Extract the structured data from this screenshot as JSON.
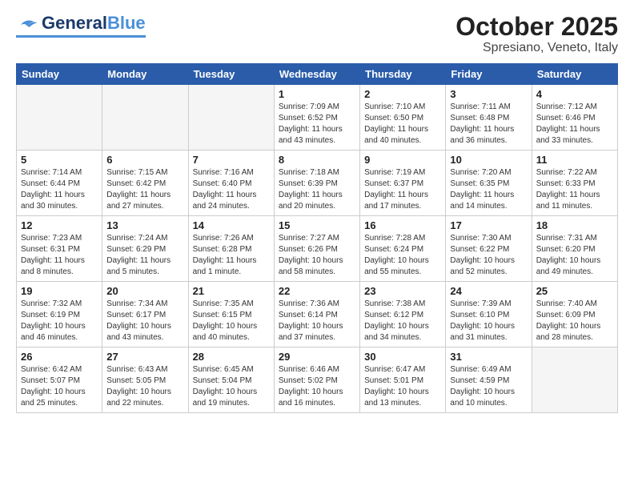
{
  "header": {
    "logo_general": "General",
    "logo_blue": "Blue",
    "month": "October 2025",
    "location": "Spresiano, Veneto, Italy"
  },
  "days_of_week": [
    "Sunday",
    "Monday",
    "Tuesday",
    "Wednesday",
    "Thursday",
    "Friday",
    "Saturday"
  ],
  "weeks": [
    [
      {
        "day": "",
        "info": ""
      },
      {
        "day": "",
        "info": ""
      },
      {
        "day": "",
        "info": ""
      },
      {
        "day": "1",
        "info": "Sunrise: 7:09 AM\nSunset: 6:52 PM\nDaylight: 11 hours\nand 43 minutes."
      },
      {
        "day": "2",
        "info": "Sunrise: 7:10 AM\nSunset: 6:50 PM\nDaylight: 11 hours\nand 40 minutes."
      },
      {
        "day": "3",
        "info": "Sunrise: 7:11 AM\nSunset: 6:48 PM\nDaylight: 11 hours\nand 36 minutes."
      },
      {
        "day": "4",
        "info": "Sunrise: 7:12 AM\nSunset: 6:46 PM\nDaylight: 11 hours\nand 33 minutes."
      }
    ],
    [
      {
        "day": "5",
        "info": "Sunrise: 7:14 AM\nSunset: 6:44 PM\nDaylight: 11 hours\nand 30 minutes."
      },
      {
        "day": "6",
        "info": "Sunrise: 7:15 AM\nSunset: 6:42 PM\nDaylight: 11 hours\nand 27 minutes."
      },
      {
        "day": "7",
        "info": "Sunrise: 7:16 AM\nSunset: 6:40 PM\nDaylight: 11 hours\nand 24 minutes."
      },
      {
        "day": "8",
        "info": "Sunrise: 7:18 AM\nSunset: 6:39 PM\nDaylight: 11 hours\nand 20 minutes."
      },
      {
        "day": "9",
        "info": "Sunrise: 7:19 AM\nSunset: 6:37 PM\nDaylight: 11 hours\nand 17 minutes."
      },
      {
        "day": "10",
        "info": "Sunrise: 7:20 AM\nSunset: 6:35 PM\nDaylight: 11 hours\nand 14 minutes."
      },
      {
        "day": "11",
        "info": "Sunrise: 7:22 AM\nSunset: 6:33 PM\nDaylight: 11 hours\nand 11 minutes."
      }
    ],
    [
      {
        "day": "12",
        "info": "Sunrise: 7:23 AM\nSunset: 6:31 PM\nDaylight: 11 hours\nand 8 minutes."
      },
      {
        "day": "13",
        "info": "Sunrise: 7:24 AM\nSunset: 6:29 PM\nDaylight: 11 hours\nand 5 minutes."
      },
      {
        "day": "14",
        "info": "Sunrise: 7:26 AM\nSunset: 6:28 PM\nDaylight: 11 hours\nand 1 minute."
      },
      {
        "day": "15",
        "info": "Sunrise: 7:27 AM\nSunset: 6:26 PM\nDaylight: 10 hours\nand 58 minutes."
      },
      {
        "day": "16",
        "info": "Sunrise: 7:28 AM\nSunset: 6:24 PM\nDaylight: 10 hours\nand 55 minutes."
      },
      {
        "day": "17",
        "info": "Sunrise: 7:30 AM\nSunset: 6:22 PM\nDaylight: 10 hours\nand 52 minutes."
      },
      {
        "day": "18",
        "info": "Sunrise: 7:31 AM\nSunset: 6:20 PM\nDaylight: 10 hours\nand 49 minutes."
      }
    ],
    [
      {
        "day": "19",
        "info": "Sunrise: 7:32 AM\nSunset: 6:19 PM\nDaylight: 10 hours\nand 46 minutes."
      },
      {
        "day": "20",
        "info": "Sunrise: 7:34 AM\nSunset: 6:17 PM\nDaylight: 10 hours\nand 43 minutes."
      },
      {
        "day": "21",
        "info": "Sunrise: 7:35 AM\nSunset: 6:15 PM\nDaylight: 10 hours\nand 40 minutes."
      },
      {
        "day": "22",
        "info": "Sunrise: 7:36 AM\nSunset: 6:14 PM\nDaylight: 10 hours\nand 37 minutes."
      },
      {
        "day": "23",
        "info": "Sunrise: 7:38 AM\nSunset: 6:12 PM\nDaylight: 10 hours\nand 34 minutes."
      },
      {
        "day": "24",
        "info": "Sunrise: 7:39 AM\nSunset: 6:10 PM\nDaylight: 10 hours\nand 31 minutes."
      },
      {
        "day": "25",
        "info": "Sunrise: 7:40 AM\nSunset: 6:09 PM\nDaylight: 10 hours\nand 28 minutes."
      }
    ],
    [
      {
        "day": "26",
        "info": "Sunrise: 6:42 AM\nSunset: 5:07 PM\nDaylight: 10 hours\nand 25 minutes."
      },
      {
        "day": "27",
        "info": "Sunrise: 6:43 AM\nSunset: 5:05 PM\nDaylight: 10 hours\nand 22 minutes."
      },
      {
        "day": "28",
        "info": "Sunrise: 6:45 AM\nSunset: 5:04 PM\nDaylight: 10 hours\nand 19 minutes."
      },
      {
        "day": "29",
        "info": "Sunrise: 6:46 AM\nSunset: 5:02 PM\nDaylight: 10 hours\nand 16 minutes."
      },
      {
        "day": "30",
        "info": "Sunrise: 6:47 AM\nSunset: 5:01 PM\nDaylight: 10 hours\nand 13 minutes."
      },
      {
        "day": "31",
        "info": "Sunrise: 6:49 AM\nSunset: 4:59 PM\nDaylight: 10 hours\nand 10 minutes."
      },
      {
        "day": "",
        "info": ""
      }
    ]
  ]
}
